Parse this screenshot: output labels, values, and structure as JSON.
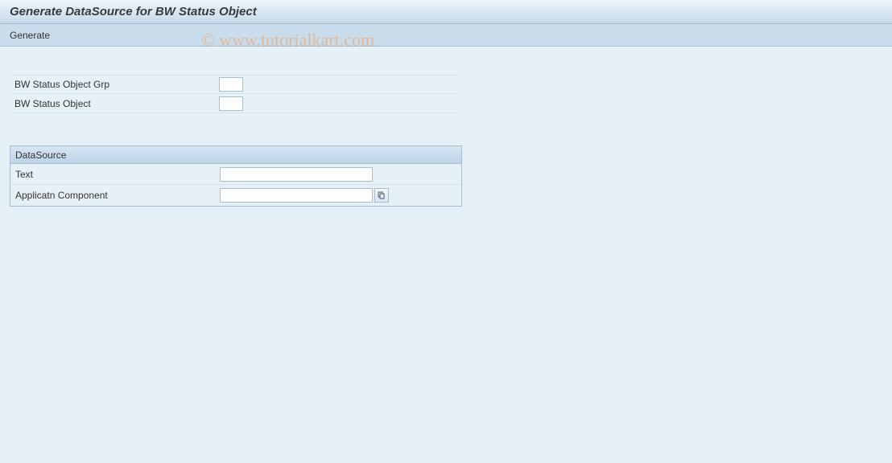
{
  "title": "Generate DataSource for BW Status Object",
  "toolbar": {
    "generate_label": "Generate"
  },
  "fields": {
    "grp_label": "BW Status Object Grp",
    "grp_value": "",
    "obj_label": "BW Status Object",
    "obj_value": ""
  },
  "panel": {
    "header": "DataSource",
    "text_label": "Text",
    "text_value": "",
    "component_label": "Applicatn Component",
    "component_value": ""
  },
  "watermark": "© www.tutorialkart.com"
}
